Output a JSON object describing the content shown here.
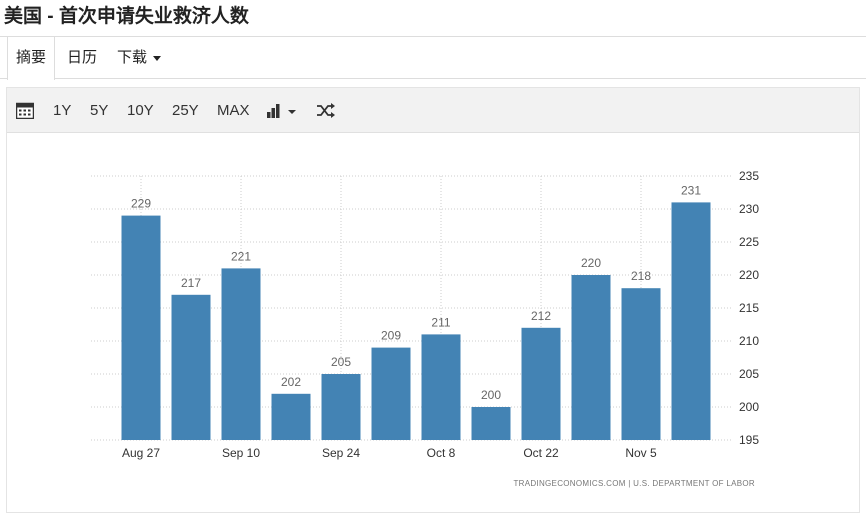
{
  "page": {
    "title": "美国 - 首次申请失业救济人数"
  },
  "tabs": [
    {
      "label": "摘要",
      "active": true
    },
    {
      "label": "日历"
    },
    {
      "label": "下载"
    }
  ],
  "toolbar": {
    "ranges": [
      "1Y",
      "5Y",
      "10Y",
      "25Y",
      "MAX"
    ],
    "icons": {
      "calendar": "calendar-icon",
      "chart_type": "bar-chart-icon",
      "dropdown": "caret-down-icon",
      "shuffle": "shuffle-icon"
    }
  },
  "colors": {
    "bar": "#4383b4",
    "grid": "#cccccc",
    "axis_text": "#333333",
    "label_text": "#666666"
  },
  "chart_data": {
    "type": "bar",
    "title": "",
    "xlabel": "",
    "ylabel": "",
    "values": [
      229,
      217,
      221,
      202,
      205,
      209,
      211,
      200,
      212,
      220,
      218,
      231
    ],
    "x_ticks": [
      "Aug 27",
      "Sep 10",
      "Sep 24",
      "Oct 8",
      "Oct 22",
      "Nov 5"
    ],
    "x_tick_bar_index": [
      0,
      2,
      4,
      6,
      8,
      10
    ],
    "ylim": [
      195,
      235
    ],
    "y_ticks": [
      195,
      200,
      205,
      210,
      215,
      220,
      225,
      230,
      235
    ],
    "y_axis_position": "right",
    "grid": true,
    "data_labels": true,
    "source": "TRADINGECONOMICS.COM | U.S. DEPARTMENT OF LABOR"
  }
}
